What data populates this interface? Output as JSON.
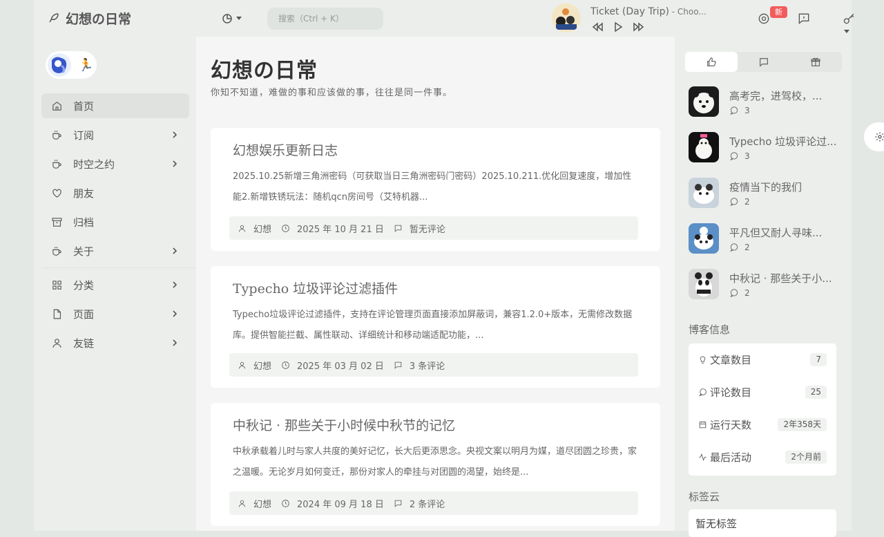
{
  "site": {
    "logo_text": "幻想の日常"
  },
  "sidebar": {
    "items": [
      {
        "label": "首页",
        "icon": "home-icon",
        "active": true,
        "chevron": false
      },
      {
        "label": "订阅",
        "icon": "cup-icon",
        "chevron": true
      },
      {
        "label": "时空之约",
        "icon": "cup-icon",
        "chevron": true
      },
      {
        "label": "朋友",
        "icon": "heart-icon",
        "chevron": false
      },
      {
        "label": "归档",
        "icon": "archive-icon",
        "chevron": false
      },
      {
        "label": "关于",
        "icon": "cup-icon",
        "chevron": true
      },
      {
        "label": "分类",
        "icon": "grid-icon",
        "chevron": true
      },
      {
        "label": "页面",
        "icon": "file-icon",
        "chevron": true
      },
      {
        "label": "友链",
        "icon": "user-icon",
        "chevron": true
      }
    ]
  },
  "topbar": {
    "search_placeholder": "搜索（Ctrl + K）",
    "player": {
      "title": "Ticket (Day Trip)",
      "artist": " - Choo..."
    },
    "new_badge": "新"
  },
  "main": {
    "title": "幻想の日常",
    "subtitle": "你知不知道，难做的事和应该做的事，往往是同一件事。",
    "posts": [
      {
        "title": "幻想娱乐更新日志",
        "excerpt": "2025.10.25新增三角洲密码（可获取当日三角洲密码门密码）2025.10.211.优化回复速度，增加性能2.新增铁锈玩法：随机qcn房间号（艾特机器...",
        "author": "幻想",
        "date": "2025 年 10 月 21 日",
        "comments": "暂无评论"
      },
      {
        "title": "Typecho 垃圾评论过滤插件",
        "excerpt": "Typecho垃圾评论过滤插件，支持在评论管理页面直接添加屏蔽词，兼容1.2.0+版本，无需修改数据库。提供智能拦截、属性联动、详细统计和移动端适配功能，...",
        "author": "幻想",
        "date": "2025 年 03 月 02 日",
        "comments": "3 条评论"
      },
      {
        "title": "中秋记 · 那些关于小时候中秋节的记忆",
        "excerpt": "中秋承载着儿时与家人共度的美好记忆，长大后更添思念。央视文案以明月为媒，道尽团圆之珍贵，家之温暖。无论岁月如何变迁，那份对家人的牵挂与对团圆的渴望，始终是...",
        "author": "幻想",
        "date": "2024 年 09 月 18 日",
        "comments": "2 条评论"
      }
    ]
  },
  "right": {
    "popular": [
      {
        "title": "高考完，进驾校，...",
        "count": "3"
      },
      {
        "title": "Typecho 垃圾评论过...",
        "count": "3"
      },
      {
        "title": "疫情当下的我们",
        "count": "2"
      },
      {
        "title": "平凡但又耐人寻味...",
        "count": "2"
      },
      {
        "title": "中秋记 · 那些关于小...",
        "count": "2"
      }
    ],
    "blog_info_title": "博客信息",
    "blog_info": [
      {
        "label": "文章数目",
        "value": "7",
        "icon": "bulb-icon"
      },
      {
        "label": "评论数目",
        "value": "25",
        "icon": "comment-icon"
      },
      {
        "label": "运行天数",
        "value": "2年358天",
        "icon": "calendar-icon"
      },
      {
        "label": "最后活动",
        "value": "2个月前",
        "icon": "activity-icon"
      }
    ],
    "tag_cloud_title": "标签云",
    "tag_cloud_empty": "暂无标签"
  }
}
